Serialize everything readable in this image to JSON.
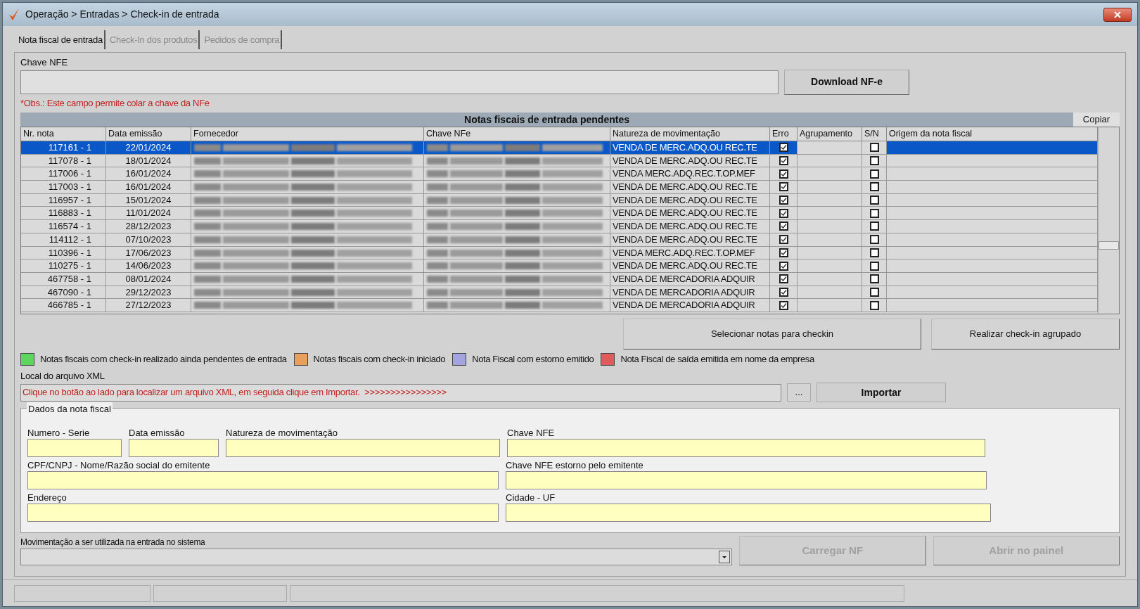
{
  "window": {
    "title": "Operação > Entradas > Check-in de entrada"
  },
  "tabs": [
    {
      "label": "Nota fiscal de entrada",
      "selected": true
    },
    {
      "label": "Check-In dos produtos",
      "selected": false
    },
    {
      "label": "Pedidos de compra",
      "selected": false
    }
  ],
  "chave_nfe": {
    "label": "Chave NFE",
    "button": "Download NF-e",
    "note": "*Obs.: Este campo permite colar a chave da NFe"
  },
  "grid": {
    "title": "Notas fiscais de entrada pendentes",
    "copy_button": "Copiar",
    "columns": [
      "Nr. nota",
      "Data emissão",
      "Fornecedor",
      "Chave NFe",
      "Natureza de movimentação",
      "Erro",
      "Agrupamento",
      "S/N",
      "Origem da nota fiscal"
    ],
    "rows": [
      {
        "nr_nota": "117161 - 1",
        "data_emissao": "22/01/2024",
        "natureza": "VENDA DE MERC.ADQ.OU REC.TE",
        "erro": true,
        "sn": false,
        "selected": true
      },
      {
        "nr_nota": "117078 - 1",
        "data_emissao": "18/01/2024",
        "natureza": "VENDA DE MERC.ADQ.OU REC.TE",
        "erro": true,
        "sn": false,
        "selected": false
      },
      {
        "nr_nota": "117006 - 1",
        "data_emissao": "16/01/2024",
        "natureza": "VENDA MERC.ADQ.REC.T.OP.MEF",
        "erro": true,
        "sn": false,
        "selected": false
      },
      {
        "nr_nota": "117003 - 1",
        "data_emissao": "16/01/2024",
        "natureza": "VENDA DE MERC.ADQ.OU REC.TE",
        "erro": true,
        "sn": false,
        "selected": false
      },
      {
        "nr_nota": "116957 - 1",
        "data_emissao": "15/01/2024",
        "natureza": "VENDA DE MERC.ADQ.OU REC.TE",
        "erro": true,
        "sn": false,
        "selected": false
      },
      {
        "nr_nota": "116883 - 1",
        "data_emissao": "11/01/2024",
        "natureza": "VENDA DE MERC.ADQ.OU REC.TE",
        "erro": true,
        "sn": false,
        "selected": false
      },
      {
        "nr_nota": "116574 - 1",
        "data_emissao": "28/12/2023",
        "natureza": "VENDA DE MERC.ADQ.OU REC.TE",
        "erro": true,
        "sn": false,
        "selected": false
      },
      {
        "nr_nota": "114112 - 1",
        "data_emissao": "07/10/2023",
        "natureza": "VENDA DE MERC.ADQ.OU REC.TE",
        "erro": true,
        "sn": false,
        "selected": false
      },
      {
        "nr_nota": "110396 - 1",
        "data_emissao": "17/06/2023",
        "natureza": "VENDA MERC.ADQ.REC.T.OP.MEF",
        "erro": true,
        "sn": false,
        "selected": false
      },
      {
        "nr_nota": "110275 - 1",
        "data_emissao": "14/06/2023",
        "natureza": "VENDA DE MERC.ADQ.OU REC.TE",
        "erro": true,
        "sn": false,
        "selected": false
      },
      {
        "nr_nota": "467758 - 1",
        "data_emissao": "08/01/2024",
        "natureza": "VENDA DE MERCADORIA ADQUIR",
        "erro": true,
        "sn": false,
        "selected": false
      },
      {
        "nr_nota": "467090 - 1",
        "data_emissao": "29/12/2023",
        "natureza": "VENDA DE MERCADORIA ADQUIR",
        "erro": true,
        "sn": false,
        "selected": false
      },
      {
        "nr_nota": "466785 - 1",
        "data_emissao": "27/12/2023",
        "natureza": "VENDA DE MERCADORIA ADQUIR",
        "erro": true,
        "sn": false,
        "selected": false
      }
    ]
  },
  "grid_buttons": [
    "Selecionar notas para checkin",
    "Realizar check-in agrupado"
  ],
  "legend": [
    {
      "label": "Notas fiscais com check-in realizado ainda pendentes de entrada",
      "color": "#5cd65c"
    },
    {
      "label": "Notas fiscais com check-in iniciado",
      "color": "#e8a05c"
    },
    {
      "label": "Nota Fiscal com estorno emitido",
      "color": "#a4a4e4"
    },
    {
      "label": "Nota Fiscal de saída emitida em nome da empresa",
      "color": "#e05c5c"
    }
  ],
  "xml": {
    "label": "Local do arquivo XML",
    "value": "Clique no botão ao lado para localizar um arquivo XML, em seguida clique em Importar.  >>>>>>>>>>>>>>>>",
    "browse_button": "...",
    "import_button": "Importar"
  },
  "dados": {
    "title": "Dados da nota fiscal",
    "rows": [
      [
        {
          "label": "Numero - Serie"
        },
        {
          "label": "Data emissão"
        },
        {
          "label": "Natureza de movimentação"
        },
        {
          "label": "Chave NFE"
        }
      ],
      [
        {
          "label": "CPF/CNPJ - Nome/Razão social do emitente"
        },
        {
          "label": "Chave NFE estorno pelo emitente"
        }
      ],
      [
        {
          "label": "Endereço"
        },
        {
          "label": "Cidade - UF"
        }
      ]
    ]
  },
  "movimentacao": {
    "label": "Movimentação a ser utilizada na entrada no sistema"
  },
  "action_buttons": [
    {
      "label": "Carregar NF",
      "disabled": true
    },
    {
      "label": "Abrir no painel",
      "disabled": true
    }
  ]
}
